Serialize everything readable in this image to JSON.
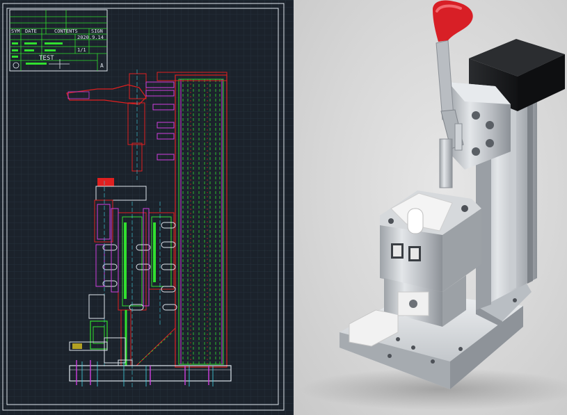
{
  "cad_drawing": {
    "title_block": {
      "headers": [
        "SYM",
        "DATE",
        "CONTENTS",
        "SIGN"
      ],
      "date": "2020.9.14",
      "part_name": "TEST",
      "sheet": "1/1",
      "size": "A"
    }
  },
  "colors": {
    "cad_background": "#1b222b",
    "cad_green": "#31e02f",
    "cad_red": "#e02020",
    "cad_magenta": "#d040e0",
    "cad_cyan": "#40d8e8",
    "cad_white": "#dfe6ee",
    "clamp_handle": "#d81f26"
  }
}
